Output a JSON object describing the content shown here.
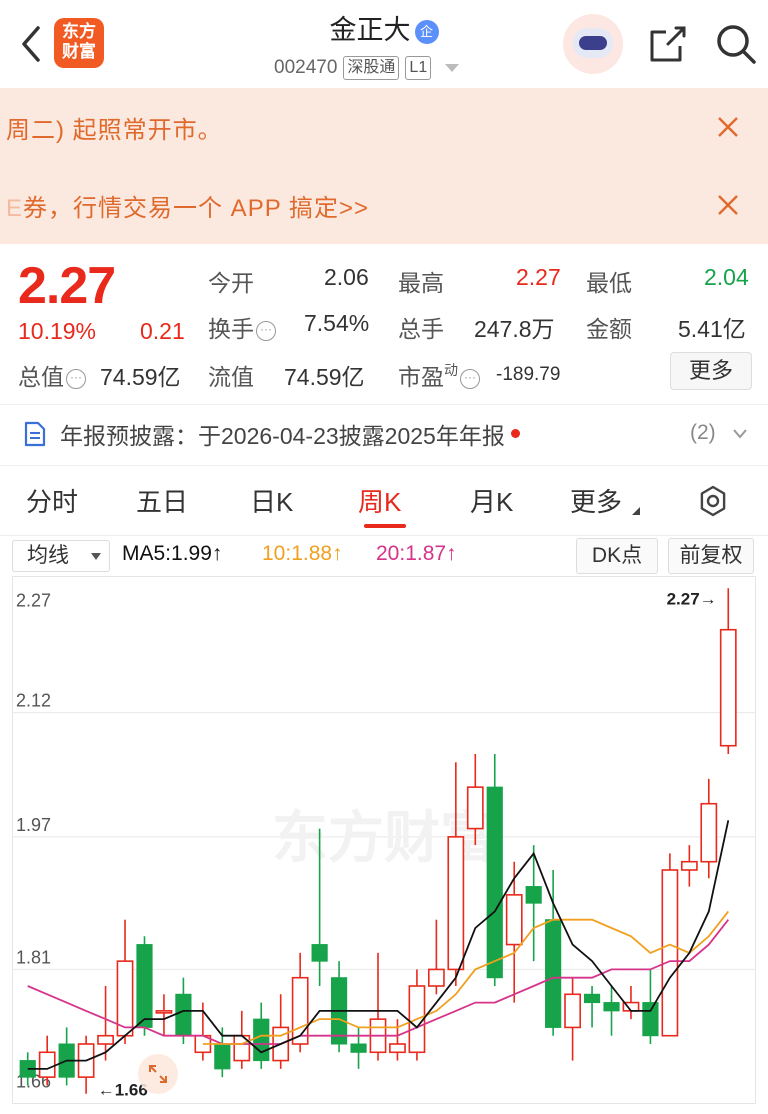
{
  "header": {
    "logo_text_1": "东方",
    "logo_text_2": "财富",
    "stock_name": "金正大",
    "badge": "企",
    "stock_code": "002470",
    "tag_connect": "深股通",
    "tag_level": "L1"
  },
  "notices": [
    {
      "text": "周二) 起照常开市。"
    },
    {
      "text_faded": "E",
      "text": "券，行情交易一个 APP 搞定>>"
    }
  ],
  "quote": {
    "price": "2.27",
    "change_pct": "10.19%",
    "change_abs": "0.21",
    "open_label": "今开",
    "open": "2.06",
    "high_label": "最高",
    "high": "2.27",
    "low_label": "最低",
    "low": "2.04",
    "turnover_label": "换手",
    "turnover": "7.54%",
    "volume_label": "总手",
    "volume": "247.8万",
    "amount_label": "金额",
    "amount": "5.41亿",
    "mktcap_label": "总值",
    "mktcap": "74.59亿",
    "float_label": "流值",
    "float": "74.59亿",
    "pe_label": "市盈",
    "pe_sup": "动",
    "pe": "-189.79",
    "more_label": "更多"
  },
  "report": {
    "text": "年报预披露：于2026-04-23披露2025年年报",
    "count": "(2)"
  },
  "tabs": [
    {
      "label": "分时"
    },
    {
      "label": "五日"
    },
    {
      "label": "日K"
    },
    {
      "label": "周K"
    },
    {
      "label": "月K"
    },
    {
      "label": "更多"
    }
  ],
  "indicators": {
    "ma_select": "均线",
    "ma5": "MA5:1.99↑",
    "ma10": "10:1.88↑",
    "ma20": "20:1.87↑",
    "dk_label": "DK点",
    "adj_label": "前复权",
    "ma5_color": "#111111",
    "ma10_color": "#f0a01e",
    "ma20_color": "#d6338a"
  },
  "chart_data": {
    "type": "candlestick",
    "y_ticks": [
      "2.27",
      "2.12",
      "1.97",
      "1.81",
      "1.66"
    ],
    "ylim": [
      1.65,
      2.28
    ],
    "max_label": "2.27→",
    "min_label": "←1.66",
    "watermark": "东方财富",
    "up_color": "#e8291c",
    "down_color": "#16a34a",
    "candles": [
      [
        1.7,
        1.68,
        1.71,
        1.67
      ],
      [
        1.68,
        1.71,
        1.73,
        1.67
      ],
      [
        1.72,
        1.68,
        1.74,
        1.67
      ],
      [
        1.68,
        1.72,
        1.73,
        1.66
      ],
      [
        1.72,
        1.73,
        1.79,
        1.7
      ],
      [
        1.73,
        1.82,
        1.87,
        1.72
      ],
      [
        1.84,
        1.74,
        1.85,
        1.73
      ],
      [
        1.76,
        1.76,
        1.78,
        1.73
      ],
      [
        1.78,
        1.73,
        1.8,
        1.72
      ],
      [
        1.71,
        1.73,
        1.77,
        1.7
      ],
      [
        1.72,
        1.69,
        1.74,
        1.68
      ],
      [
        1.7,
        1.73,
        1.76,
        1.69
      ],
      [
        1.75,
        1.7,
        1.77,
        1.69
      ],
      [
        1.7,
        1.74,
        1.78,
        1.69
      ],
      [
        1.72,
        1.8,
        1.83,
        1.71
      ],
      [
        1.84,
        1.82,
        1.98,
        1.79
      ],
      [
        1.8,
        1.72,
        1.82,
        1.71
      ],
      [
        1.72,
        1.71,
        1.74,
        1.69
      ],
      [
        1.71,
        1.75,
        1.83,
        1.7
      ],
      [
        1.71,
        1.72,
        1.75,
        1.7
      ],
      [
        1.71,
        1.79,
        1.81,
        1.7
      ],
      [
        1.79,
        1.81,
        1.87,
        1.78
      ],
      [
        1.81,
        1.97,
        2.06,
        1.79
      ],
      [
        1.98,
        2.03,
        2.07,
        1.96
      ],
      [
        2.03,
        1.8,
        2.07,
        1.79
      ],
      [
        1.84,
        1.9,
        1.94,
        1.77
      ],
      [
        1.91,
        1.89,
        1.96,
        1.82
      ],
      [
        1.87,
        1.74,
        1.93,
        1.73
      ],
      [
        1.74,
        1.78,
        1.8,
        1.7
      ],
      [
        1.78,
        1.77,
        1.79,
        1.74
      ],
      [
        1.77,
        1.76,
        1.79,
        1.73
      ],
      [
        1.76,
        1.77,
        1.79,
        1.75
      ],
      [
        1.77,
        1.73,
        1.81,
        1.72
      ],
      [
        1.73,
        1.93,
        1.95,
        1.73
      ],
      [
        1.93,
        1.94,
        1.96,
        1.91
      ],
      [
        1.94,
        2.01,
        2.04,
        1.92
      ],
      [
        2.08,
        2.22,
        2.27,
        2.07
      ]
    ],
    "ma5": [
      1.69,
      1.69,
      1.7,
      1.7,
      1.71,
      1.73,
      1.75,
      1.75,
      1.76,
      1.76,
      1.73,
      1.73,
      1.71,
      1.72,
      1.73,
      1.76,
      1.76,
      1.76,
      1.76,
      1.76,
      1.74,
      1.77,
      1.8,
      1.86,
      1.88,
      1.92,
      1.95,
      1.89,
      1.84,
      1.82,
      1.79,
      1.76,
      1.76,
      1.8,
      1.83,
      1.88,
      1.99
    ],
    "ma10": [
      null,
      null,
      null,
      null,
      null,
      null,
      null,
      null,
      null,
      1.72,
      1.72,
      1.72,
      1.73,
      1.73,
      1.74,
      1.75,
      1.75,
      1.74,
      1.74,
      1.74,
      1.75,
      1.76,
      1.78,
      1.81,
      1.82,
      1.83,
      1.86,
      1.87,
      1.87,
      1.87,
      1.86,
      1.85,
      1.83,
      1.84,
      1.83,
      1.85,
      1.88
    ],
    "ma20": [
      1.79,
      1.78,
      1.77,
      1.76,
      1.75,
      1.74,
      1.74,
      1.73,
      1.73,
      1.73,
      1.72,
      1.72,
      1.72,
      1.72,
      1.73,
      1.73,
      1.73,
      1.73,
      1.73,
      1.73,
      1.74,
      1.75,
      1.76,
      1.77,
      1.77,
      1.78,
      1.79,
      1.8,
      1.8,
      1.8,
      1.81,
      1.81,
      1.81,
      1.82,
      1.82,
      1.84,
      1.87
    ]
  }
}
